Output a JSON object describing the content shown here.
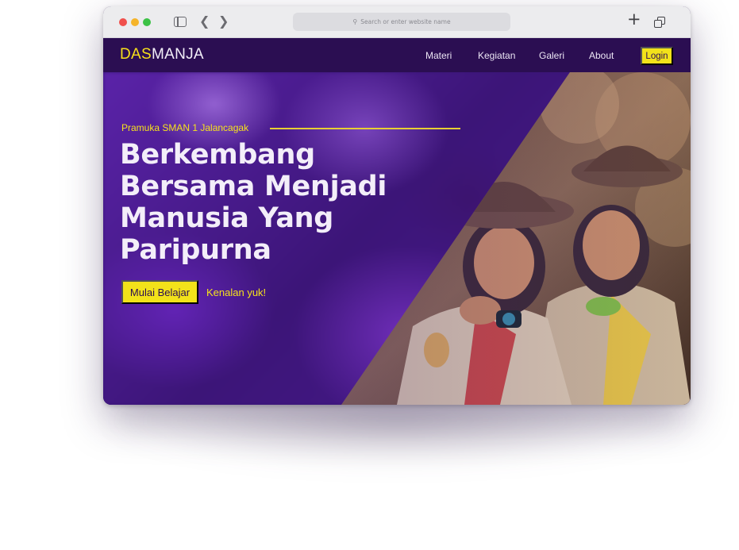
{
  "browser": {
    "url_placeholder": "Search or enter website name",
    "back_icon": "chevron-left-icon",
    "forward_icon": "chevron-right-icon",
    "new_tab_icon": "plus-icon",
    "tabs_icon": "tabs-overview-icon"
  },
  "site": {
    "logo_part1": "DAS",
    "logo_part2": "MANJA",
    "nav": [
      {
        "label": "Materi"
      },
      {
        "label": "Kegiatan"
      },
      {
        "label": "Galeri"
      },
      {
        "label": "About"
      }
    ],
    "login_label": "Login"
  },
  "hero": {
    "subtitle": "Pramuka SMAN 1 Jalancagak",
    "title_lines": [
      "Berkembang",
      "Bersama Menjadi",
      "Manusia Yang",
      "Paripurna"
    ],
    "primary_cta": "Mulai Belajar",
    "secondary_cta": "Kenalan yuk!"
  },
  "colors": {
    "accent": "#f2e21a",
    "navbar": "#2b0e52",
    "hero_purple": "#3b1678"
  }
}
